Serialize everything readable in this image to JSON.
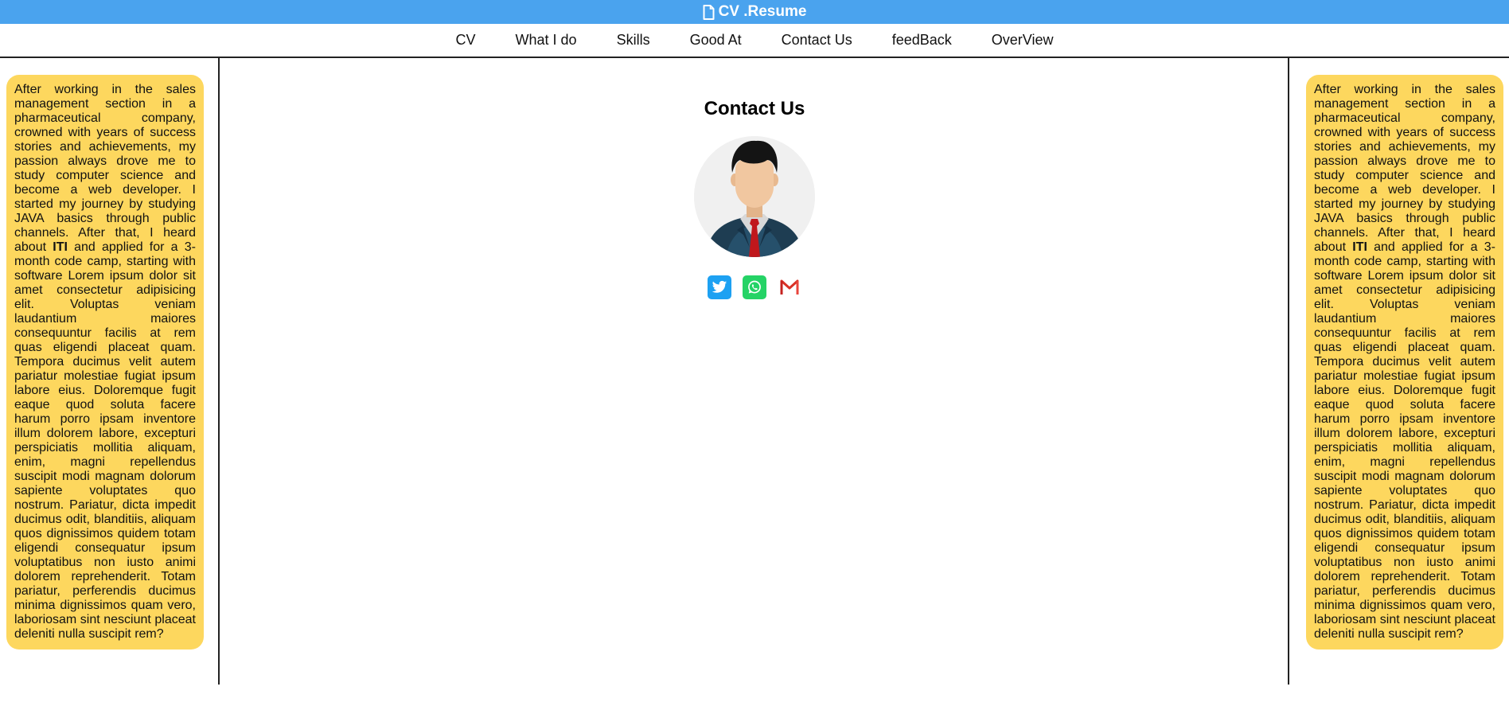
{
  "brand": {
    "icon": "file-icon",
    "title": "CV .Resume"
  },
  "nav": {
    "items": [
      {
        "label": "CV"
      },
      {
        "label": "What I do"
      },
      {
        "label": "Skills"
      },
      {
        "label": "Good At"
      },
      {
        "label": "Contact Us"
      },
      {
        "label": "feedBack"
      },
      {
        "label": "OverView"
      }
    ]
  },
  "bio": {
    "before_bold": "After working in the sales management section in a pharmaceutical company, crowned with years of success stories and achievements, my passion always drove me to study computer science and become a web developer. I started my journey by studying JAVA basics through public channels. After that, I heard about ",
    "bold": "ITI",
    "after_bold": " and applied for a 3-month code camp, starting with software Lorem ipsum dolor sit amet consectetur adipisicing elit. Voluptas veniam laudantium maiores consequuntur facilis at rem quas eligendi placeat quam. Tempora ducimus velit autem pariatur molestiae fugiat ipsum labore eius. Doloremque fugit eaque quod soluta facere harum porro ipsam inventore illum dolorem labore, excepturi perspiciatis mollitia aliquam, enim, magni repellendus suscipit modi magnam dolorum sapiente voluptates quo nostrum. Pariatur, dicta impedit ducimus odit, blanditiis, aliquam quos dignissimos quidem totam eligendi consequatur ipsum voluptatibus non iusto animi dolorem reprehenderit. Totam pariatur, perferendis ducimus minima dignissimos quam vero, laboriosam sint nesciunt placeat deleniti nulla suscipit rem?"
  },
  "contact": {
    "title": "Contact Us",
    "avatar": "person-avatar",
    "socials": [
      {
        "icon": "twitter-icon",
        "color": "#1da1f2"
      },
      {
        "icon": "whatsapp-icon",
        "color": "#25d366"
      },
      {
        "icon": "gmail-icon",
        "color": "#d93025"
      }
    ]
  },
  "colors": {
    "topbar": "#4aa3ee",
    "bio_card": "#fdd75e"
  }
}
